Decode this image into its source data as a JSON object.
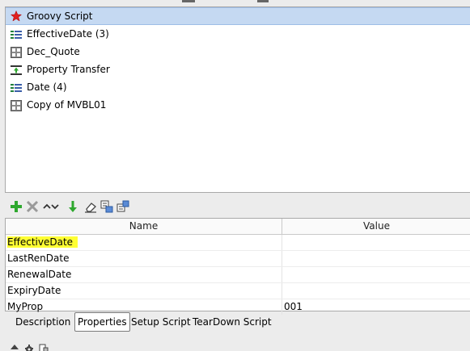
{
  "steps": [
    {
      "label": "Groovy Script",
      "icon": "star-icon",
      "selected": true
    },
    {
      "label": "EffectiveDate (3)",
      "icon": "datasource-icon"
    },
    {
      "label": "Dec_Quote",
      "icon": "request-icon"
    },
    {
      "label": "Property Transfer",
      "icon": "property-transfer-icon"
    },
    {
      "label": "Date (4)",
      "icon": "datasource-icon"
    },
    {
      "label": "Copy of MVBL01",
      "icon": "request-icon"
    }
  ],
  "toolbar": {
    "icons": [
      "add-icon",
      "remove-icon",
      "move-up-down-icon",
      "move-down-icon",
      "clear-icon",
      "load-icon",
      "save-icon"
    ]
  },
  "properties": {
    "columns": {
      "name": "Name",
      "value": "Value"
    },
    "rows": [
      {
        "name": "EffectiveDate",
        "value": "",
        "highlighted": true
      },
      {
        "name": "LastRenDate",
        "value": ""
      },
      {
        "name": "RenewalDate",
        "value": ""
      },
      {
        "name": "ExpiryDate",
        "value": ""
      },
      {
        "name": "MyProp",
        "value": "001"
      }
    ]
  },
  "tabs": [
    {
      "label": "Description"
    },
    {
      "label": "Properties",
      "active": true
    },
    {
      "label": "Setup Script"
    },
    {
      "label": "TearDown Script"
    }
  ],
  "colors": {
    "selection": "#c5d9f2",
    "highlight": "#ffff33",
    "add_green": "#2ea82e",
    "datasource_green": "#1f7f3a",
    "datasource_blue": "#3a5ea8"
  }
}
